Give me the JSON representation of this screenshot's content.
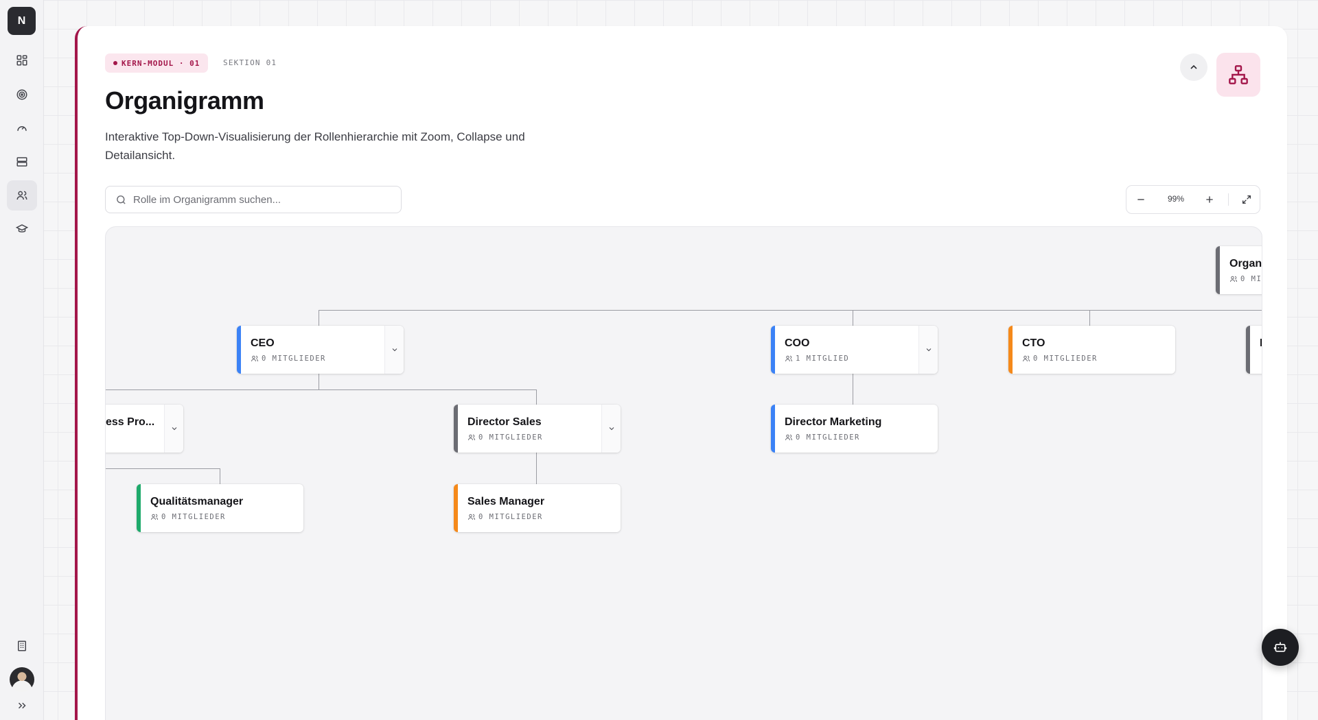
{
  "app": {
    "logo_letter": "N"
  },
  "sidebar": {
    "items": [
      {
        "name": "dashboard-icon"
      },
      {
        "name": "target-icon"
      },
      {
        "name": "gauge-icon"
      },
      {
        "name": "server-icon"
      },
      {
        "name": "users-icon",
        "active": true
      },
      {
        "name": "graduation-cap-icon"
      }
    ],
    "bottom": [
      "building-icon",
      "avatar",
      "expand-icon"
    ]
  },
  "header": {
    "badge": "KERN-MODUL · 01",
    "section": "SEKTION 01",
    "title": "Organigramm",
    "description": "Interaktive Top-Down-Visualisierung der Rollenhierarchie mit Zoom, Collapse und Detailansicht."
  },
  "search": {
    "placeholder": "Rolle im Organigramm suchen..."
  },
  "zoom": {
    "value": "99%"
  },
  "org": {
    "root": {
      "title": "Organ",
      "members": "0 MI"
    },
    "ceo": {
      "title": "CEO",
      "members": "0 MITGLIEDER"
    },
    "coo": {
      "title": "COO",
      "members": "1 MITGLIED"
    },
    "cto": {
      "title": "CTO",
      "members": "0 MITGLIEDER"
    },
    "edge_right": {
      "title": "I",
      "members": ""
    },
    "business_process": {
      "title": "ess Pro...",
      "members": ""
    },
    "director_sales": {
      "title": "Director Sales",
      "members": "0 MITGLIEDER"
    },
    "director_marketing": {
      "title": "Director Marketing",
      "members": "0 MITGLIEDER"
    },
    "qualitaetsmanager": {
      "title": "Qualitätsmanager",
      "members": "0 MITGLIEDER"
    },
    "sales_manager": {
      "title": "Sales Manager",
      "members": "0 MITGLIEDER"
    }
  },
  "colors": {
    "accent": "#a3164a",
    "blue": "#3b82f6",
    "orange": "#f5891a",
    "green": "#1eaa6b",
    "grey": "#6b6c73"
  }
}
